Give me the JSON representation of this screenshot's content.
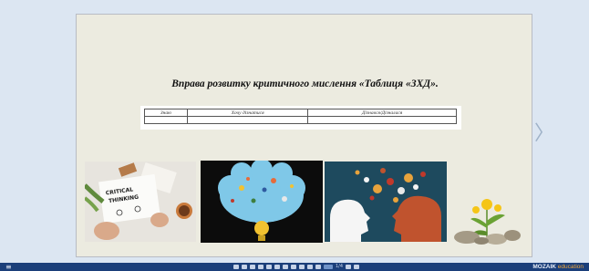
{
  "viewer": {
    "prev_arrow": "〈",
    "next_arrow": "〉"
  },
  "slide": {
    "title": "Вправа розвитку критичного мислення «Таблиця «ЗХД».",
    "table": {
      "headers": [
        "Знаю",
        "Хочу дізнатися",
        "Дізнався/Дізналася"
      ],
      "rows": [
        [
          "",
          "",
          ""
        ]
      ]
    },
    "images": [
      {
        "name": "critical-thinking-notebook-image",
        "caption": "CRITICAL THINKING"
      },
      {
        "name": "brain-lightbulb-image"
      },
      {
        "name": "two-heads-ideas-image"
      },
      {
        "name": "dandelion-rocks-image"
      }
    ]
  },
  "taskbar": {
    "menu_icon": "≡",
    "page_label": "1/4",
    "brand_main": "MOZAIK",
    "brand_sub": "education"
  },
  "colors": {
    "viewer_bg": "#dce6f2",
    "slide_bg": "#ecebe0",
    "taskbar_bg": "#1b3f7a"
  }
}
